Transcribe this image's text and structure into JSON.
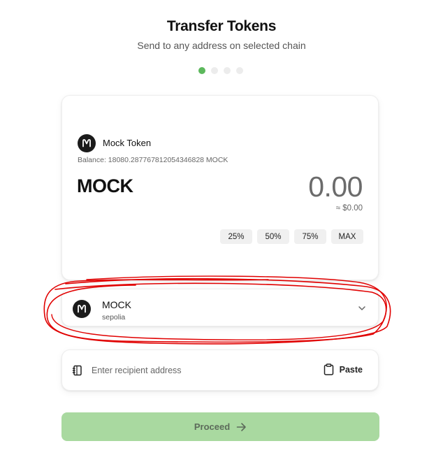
{
  "header": {
    "title": "Transfer Tokens",
    "subtitle": "Send to any address on selected chain"
  },
  "steps": {
    "total": 4,
    "current": 1
  },
  "token_panel": {
    "token_name": "Mock Token",
    "balance": "Balance: 18080.287767812054346828 MOCK",
    "symbol": "MOCK",
    "amount": "0.00",
    "usd_value": "≈ $0.00",
    "percent_buttons": [
      "25%",
      "50%",
      "75%",
      "MAX"
    ]
  },
  "chain_selector": {
    "symbol": "MOCK",
    "network": "sepolia",
    "icon": "chevron-down-icon"
  },
  "recipient": {
    "placeholder": "Enter recipient address",
    "value": "",
    "paste_label": "Paste"
  },
  "proceed": {
    "label": "Proceed",
    "enabled": false
  },
  "colors": {
    "accent": "#5cb85c",
    "proceed_bg": "#a9d9a0",
    "annotation": "#e00000"
  }
}
